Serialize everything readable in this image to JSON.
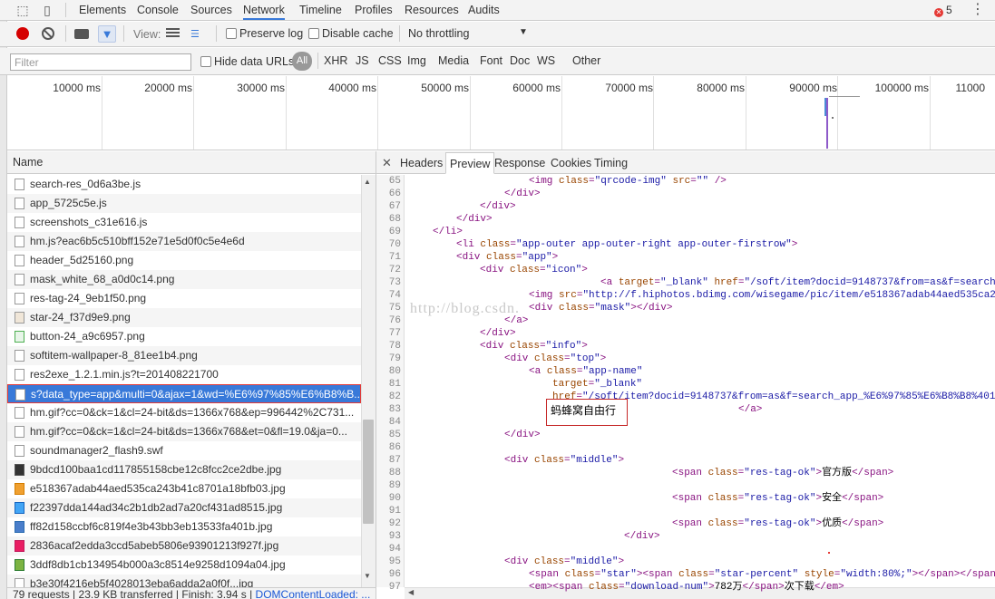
{
  "devtools": {
    "tabs": [
      "Elements",
      "Console",
      "Sources",
      "Network",
      "Timeline",
      "Profiles",
      "Resources",
      "Audits"
    ],
    "active_tab": "Network",
    "error_count": "5"
  },
  "toolbar": {
    "view_label": "View:",
    "preserve_log": "Preserve log",
    "disable_cache": "Disable cache",
    "throttling": "No throttling"
  },
  "filter": {
    "placeholder": "Filter",
    "hide_data_urls": "Hide data URLs",
    "all_label": "All",
    "types": [
      "XHR",
      "JS",
      "CSS",
      "Img",
      "Media",
      "Font",
      "Doc",
      "WS",
      "Other"
    ]
  },
  "timeline": {
    "ticks": [
      "10000 ms",
      "20000 ms",
      "30000 ms",
      "40000 ms",
      "50000 ms",
      "60000 ms",
      "70000 ms",
      "80000 ms",
      "90000 ms",
      "100000 ms",
      "11000"
    ]
  },
  "requests": {
    "header": "Name",
    "rows": [
      {
        "name": "search-res_0d6a3be.js",
        "icon": "file"
      },
      {
        "name": "app_5725c5e.js",
        "icon": "file"
      },
      {
        "name": "screenshots_c31e616.js",
        "icon": "file"
      },
      {
        "name": "hm.js?eac6b5c510bff152e71e5d0f0c5e4e6d",
        "icon": "file"
      },
      {
        "name": "header_5d25160.png",
        "icon": "file"
      },
      {
        "name": "mask_white_68_a0d0c14.png",
        "icon": "file"
      },
      {
        "name": "res-tag-24_9eb1f50.png",
        "icon": "file"
      },
      {
        "name": "star-24_f37d9e9.png",
        "icon": "png"
      },
      {
        "name": "button-24_a9c6957.png",
        "icon": "green"
      },
      {
        "name": "softitem-wallpaper-8_81ee1b4.png",
        "icon": "file"
      },
      {
        "name": "res2exe_1.2.1.min.js?t=201408221700",
        "icon": "file"
      },
      {
        "name": "s?data_type=app&multi=0&ajax=1&wd=%E6%97%85%E6%B8%B...",
        "icon": "file",
        "selected": true
      },
      {
        "name": "hm.gif?cc=0&ck=1&cl=24-bit&ds=1366x768&ep=996442%2C731...",
        "icon": "file"
      },
      {
        "name": "hm.gif?cc=0&ck=1&cl=24-bit&ds=1366x768&et=0&fl=19.0&ja=0...",
        "icon": "file"
      },
      {
        "name": "soundmanager2_flash9.swf",
        "icon": "file"
      },
      {
        "name": "9bdcd100baa1cd117855158cbe12c8fcc2ce2dbe.jpg",
        "icon": "img6"
      },
      {
        "name": "e518367adab44aed535ca243b41c8701a18bfb03.jpg",
        "icon": "img2"
      },
      {
        "name": "f22397dda144ad34c2b1db2ad7a20cf431ad8515.jpg",
        "icon": "img5"
      },
      {
        "name": "ff82d158ccbf6c819f4e3b43bb3eb13533fa401b.jpg",
        "icon": "img"
      },
      {
        "name": "2836acaf2edda3ccd5abeb5806e93901213f927f.jpg",
        "icon": "img3"
      },
      {
        "name": "3ddf8db1cb134954b000a3c8514e9258d1094a04.jpg",
        "icon": "img4"
      },
      {
        "name": "b3e30f4216eb5f4028013eba6adda2a0f0f...jpg",
        "icon": "file"
      }
    ]
  },
  "status": {
    "requests": "79 requests",
    "transferred": "23.9 KB transferred",
    "finish": "Finish: 3.94 s",
    "dcl": "DOMContentLoaded: ..."
  },
  "detail": {
    "tabs": [
      "Headers",
      "Preview",
      "Response",
      "Cookies",
      "Timing"
    ],
    "active": "Preview",
    "annotation": "蚂蜂窝自由行",
    "watermark": "http://blog.csdn."
  },
  "code_lines": [
    {
      "n": "65",
      "html": "<span style='padding-left:133px'></span>&lt;img <span class='a'>class</span>=<span class='v'>\"qrcode-img\"</span> <span class='a'>src</span>=<span class='v'>\"\"</span> /&gt;"
    },
    {
      "n": "66",
      "html": "<span style='padding-left:106px'></span>&lt;/div&gt;"
    },
    {
      "n": "67",
      "html": "<span style='padding-left:79px'></span>&lt;/div&gt;"
    },
    {
      "n": "68",
      "html": "<span style='padding-left:53px'></span>&lt;/div&gt;"
    },
    {
      "n": "69",
      "html": "<span style='padding-left:27px'></span>&lt;/li&gt;"
    },
    {
      "n": "70",
      "html": "<span style='padding-left:53px'></span>&lt;li <span class='a'>class</span>=<span class='v'>\"app-outer app-outer-right app-outer-firstrow\"</span>&gt;"
    },
    {
      "n": "71",
      "html": "<span style='padding-left:53px'></span>&lt;div <span class='a'>class</span>=<span class='v'>\"app\"</span>&gt;"
    },
    {
      "n": "72",
      "html": "<span style='padding-left:79px'></span>&lt;div <span class='a'>class</span>=<span class='v'>\"icon\"</span>&gt;"
    },
    {
      "n": "73",
      "html": "<span style='padding-left:212px'></span>&lt;a <span class='a'>target</span>=<span class='v'>\"_blank\"</span> <span class='a'>href</span>=<span class='v'>\"/soft/item?docid=9148737&amp;from=as&amp;f=search</span>"
    },
    {
      "n": "74",
      "html": "<span style='padding-left:133px'></span>&lt;img <span class='a'>src</span>=<span class='v'>\"http://f.hiphotos.bdimg.com/wisegame/pic/item/e518367adab44aed535ca2</span>"
    },
    {
      "n": "75",
      "html": "<span style='padding-left:133px'></span>&lt;div <span class='a'>class</span>=<span class='v'>\"mask\"</span>&gt;&lt;/div&gt;"
    },
    {
      "n": "76",
      "html": "<span style='padding-left:106px'></span>&lt;/a&gt;"
    },
    {
      "n": "77",
      "html": "<span style='padding-left:79px'></span>&lt;/div&gt;"
    },
    {
      "n": "78",
      "html": "<span style='padding-left:79px'></span>&lt;div <span class='a'>class</span>=<span class='v'>\"info\"</span>&gt;"
    },
    {
      "n": "79",
      "html": "<span style='padding-left:106px'></span>&lt;div <span class='a'>class</span>=<span class='v'>\"top\"</span>&gt;"
    },
    {
      "n": "80",
      "html": "<span style='padding-left:133px'></span>&lt;a <span class='a'>class</span>=<span class='v'>\"app-name\"</span>"
    },
    {
      "n": "81",
      "html": "<span style='padding-left:159px'></span><span class='a'>target</span>=<span class='v'>\"_blank\"</span>"
    },
    {
      "n": "82",
      "html": "<span style='padding-left:159px'></span><span class='a'>href</span>=<span class='v'>\"/soft/item?docid=9148737&amp;from=as&amp;f=search_app_%E6%97%85%E6%B8%B8%401</span>"
    },
    {
      "n": "83",
      "html": "<span style='padding-left:364px'></span>&lt;/a&gt;"
    },
    {
      "n": "84",
      "html": ""
    },
    {
      "n": "85",
      "html": "<span style='padding-left:106px'></span>&lt;/div&gt;"
    },
    {
      "n": "86",
      "html": ""
    },
    {
      "n": "87",
      "html": "<span style='padding-left:106px'></span>&lt;div <span class='a'>class</span>=<span class='v'>\"middle\"</span>&gt;"
    },
    {
      "n": "88",
      "html": "<span style='padding-left:291px'></span>&lt;span <span class='a'>class</span>=<span class='v'>\"res-tag-ok\"</span>&gt;<span class='t'>官方版</span>&lt;/span&gt;"
    },
    {
      "n": "89",
      "html": ""
    },
    {
      "n": "90",
      "html": "<span style='padding-left:291px'></span>&lt;span <span class='a'>class</span>=<span class='v'>\"res-tag-ok\"</span>&gt;<span class='t'>安全</span>&lt;/span&gt;"
    },
    {
      "n": "91",
      "html": ""
    },
    {
      "n": "92",
      "html": "<span style='padding-left:291px'></span>&lt;span <span class='a'>class</span>=<span class='v'>\"res-tag-ok\"</span>&gt;<span class='t'>优质</span>&lt;/span&gt;"
    },
    {
      "n": "93",
      "html": "<span style='padding-left:238px'></span>&lt;/div&gt;"
    },
    {
      "n": "94",
      "html": ""
    },
    {
      "n": "95",
      "html": "<span style='padding-left:106px'></span>&lt;div <span class='a'>class</span>=<span class='v'>\"middle\"</span>&gt;"
    },
    {
      "n": "96",
      "html": "<span style='padding-left:133px'></span>&lt;span <span class='a'>class</span>=<span class='v'>\"star\"</span>&gt;&lt;span <span class='a'>class</span>=<span class='v'>\"star-percent\"</span> <span class='a'>style</span>=<span class='v'>\"width:80%;\"</span>&gt;&lt;/span&gt;&lt;/span"
    },
    {
      "n": "97",
      "html": "<span style='padding-left:133px'></span>&lt;em&gt;&lt;span <span class='a'>class</span>=<span class='v'>\"download-num\"</span>&gt;<span class='t'>782万</span>&lt;/span&gt;<span class='t'>次下载</span>&lt;/em&gt;"
    }
  ]
}
